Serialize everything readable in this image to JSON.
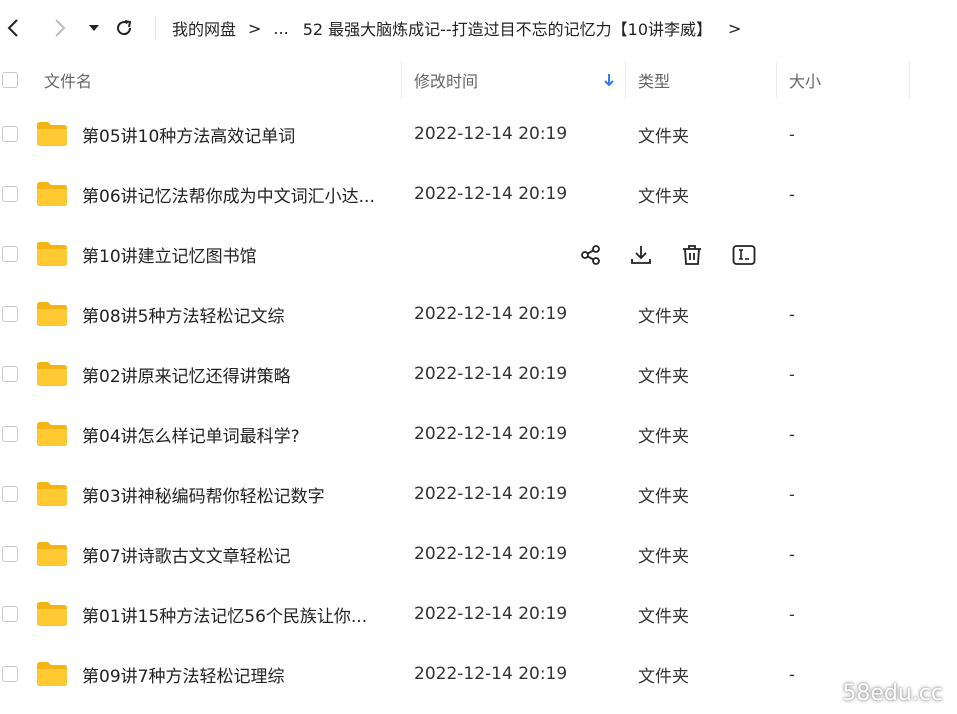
{
  "breadcrumb": {
    "root": "我的网盘",
    "separator": ">",
    "ellipsis": "...",
    "current": "52 最强大脑炼成记--打造过目不忘的记忆力【10讲李威】"
  },
  "table": {
    "headers": {
      "name": "文件名",
      "modified": "修改时间",
      "type": "类型",
      "size": "大小"
    },
    "sorted_by": "modified",
    "rows": [
      {
        "name": "第05讲10种方法高效记单词",
        "modified": "2022-12-14 20:19",
        "type": "文件夹",
        "size": "-"
      },
      {
        "name": "第06讲记忆法帮你成为中文词汇小达...",
        "modified": "2022-12-14 20:19",
        "type": "文件夹",
        "size": "-"
      },
      {
        "name": "第10讲建立记忆图书馆",
        "modified": "",
        "type": "",
        "size": "",
        "hovered": true
      },
      {
        "name": "第08讲5种方法轻松记文综",
        "modified": "2022-12-14 20:19",
        "type": "文件夹",
        "size": "-"
      },
      {
        "name": "第02讲原来记忆还得讲策略",
        "modified": "2022-12-14 20:19",
        "type": "文件夹",
        "size": "-"
      },
      {
        "name": "第04讲怎么样记单词最科学?",
        "modified": "2022-12-14 20:19",
        "type": "文件夹",
        "size": "-"
      },
      {
        "name": "第03讲神秘编码帮你轻松记数字",
        "modified": "2022-12-14 20:19",
        "type": "文件夹",
        "size": "-"
      },
      {
        "name": "第07讲诗歌古文文章轻松记",
        "modified": "2022-12-14 20:19",
        "type": "文件夹",
        "size": "-"
      },
      {
        "name": "第01讲15种方法记忆56个民族让你...",
        "modified": "2022-12-14 20:19",
        "type": "文件夹",
        "size": "-"
      },
      {
        "name": "第09讲7种方法轻松记理综",
        "modified": "2022-12-14 20:19",
        "type": "文件夹",
        "size": "-"
      }
    ],
    "hover_actions": [
      "share-icon",
      "download-icon",
      "delete-icon",
      "rename-icon"
    ]
  },
  "watermark": "58edu.cc",
  "colors": {
    "folder": "#ffc933",
    "folder_dark": "#f5b416",
    "sort_arrow": "#2f7cf6",
    "text": "#222222"
  }
}
